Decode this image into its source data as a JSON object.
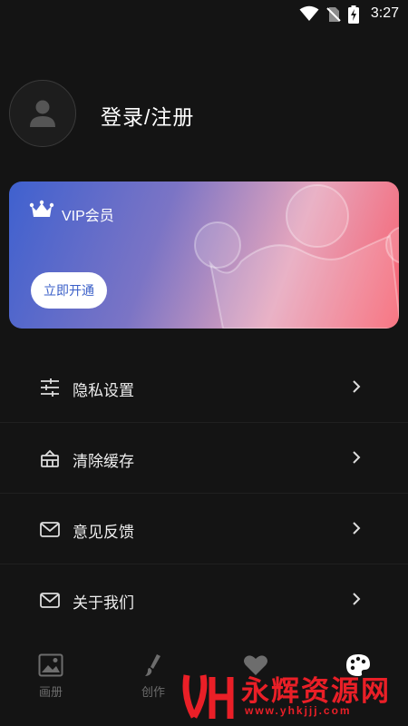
{
  "status_bar": {
    "time": "3:27",
    "icons": [
      "wifi-icon",
      "no-sim-icon",
      "battery-charging-icon"
    ]
  },
  "profile": {
    "login_label": "登录/注册",
    "avatar_icon": "user-avatar-icon"
  },
  "vip": {
    "title": "VIP会员",
    "button_label": "立即开通",
    "icon": "crown-icon",
    "gradient_colors": [
      "#3f61cf",
      "#7b74c5",
      "#e6a6bd",
      "#f7606f"
    ]
  },
  "menu": {
    "items": [
      {
        "label": "隐私设置",
        "icon": "sliders-icon"
      },
      {
        "label": "清除缓存",
        "icon": "basket-icon"
      },
      {
        "label": "意见反馈",
        "icon": "mail-icon"
      },
      {
        "label": "关于我们",
        "icon": "mail-icon"
      }
    ]
  },
  "tabs": [
    {
      "label": "画册",
      "icon": "image-icon",
      "active": false
    },
    {
      "label": "创作",
      "icon": "brush-icon",
      "active": false
    },
    {
      "label": "",
      "icon": "heart-icon",
      "active": false
    },
    {
      "label": "",
      "icon": "palette-icon",
      "active": true
    }
  ],
  "watermark": {
    "text": "永辉资源网",
    "url": "www.yhkjjj.com"
  },
  "colors": {
    "background": "#141414",
    "text": "#f2f2f2",
    "inactive_tab": "#6d6d6d",
    "watermark": "#ea1f27"
  }
}
